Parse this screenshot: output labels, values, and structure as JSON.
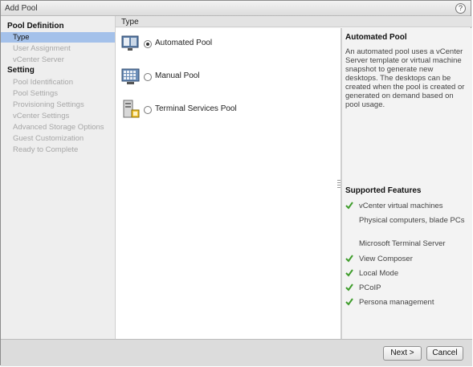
{
  "window": {
    "title": "Add Pool",
    "help_label": "?"
  },
  "nav": {
    "sections": [
      {
        "label": "Pool Definition",
        "items": [
          {
            "label": "Type",
            "active": true
          },
          {
            "label": "User Assignment"
          },
          {
            "label": "vCenter Server"
          }
        ]
      },
      {
        "label": "Setting",
        "items": [
          {
            "label": "Pool Identification"
          },
          {
            "label": "Pool Settings"
          },
          {
            "label": "Provisioning Settings"
          },
          {
            "label": "vCenter Settings"
          },
          {
            "label": "Advanced Storage Options"
          },
          {
            "label": "Guest Customization"
          },
          {
            "label": "Ready to Complete"
          }
        ]
      }
    ]
  },
  "content": {
    "header": "Type",
    "options": [
      {
        "label": "Automated Pool",
        "selected": true,
        "icon": "automated-pool-icon"
      },
      {
        "label": "Manual Pool",
        "selected": false,
        "icon": "manual-pool-icon"
      },
      {
        "label": "Terminal Services Pool",
        "selected": false,
        "icon": "terminal-services-icon"
      }
    ]
  },
  "details": {
    "title": "Automated Pool",
    "description": "An automated pool uses a vCenter Server template or virtual machine snapshot to generate new desktops. The desktops can be created when the pool is created or generated on demand based on pool usage.",
    "features_title": "Supported Features",
    "features": [
      {
        "label": "vCenter virtual machines",
        "supported": true
      },
      {
        "label": "Physical computers, blade PCs",
        "supported": false
      },
      {
        "label": "Microsoft Terminal Server",
        "supported": false
      },
      {
        "label": "View Composer",
        "supported": true
      },
      {
        "label": "Local Mode",
        "supported": true
      },
      {
        "label": "PCoIP",
        "supported": true
      },
      {
        "label": "Persona management",
        "supported": true
      }
    ]
  },
  "footer": {
    "next_label": "Next >",
    "cancel_label": "Cancel"
  },
  "colors": {
    "active_nav": "#a4c1ea",
    "check": "#3f9d2c",
    "disabled_text": "#a7a7a7"
  }
}
